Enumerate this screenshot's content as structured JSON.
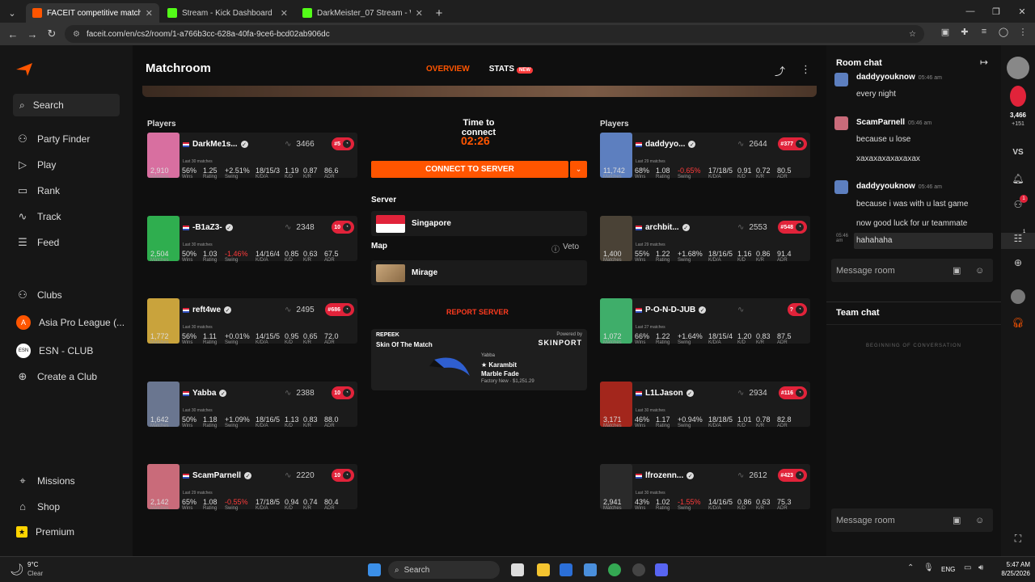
{
  "browser": {
    "tabs": [
      {
        "title": "FACEIT competitive match - FA",
        "color": "#ff5500"
      },
      {
        "title": "Stream - Kick Dashboard",
        "color": "#53fc18"
      },
      {
        "title": "DarkMeister_07 Stream - Watch",
        "color": "#53fc18"
      }
    ],
    "url": "faceit.com/en/cs2/room/1-a766b3cc-628a-40fa-9ce6-bcd02ab906dc"
  },
  "sidebar": {
    "search_label": "Search",
    "items": [
      "Party Finder",
      "Play",
      "Rank",
      "Track",
      "Feed"
    ],
    "clubs": [
      "Clubs",
      "Asia Pro League (...",
      "ESN - CLUB",
      "Create a Club"
    ],
    "bottom": [
      "Missions",
      "Shop",
      "Premium"
    ]
  },
  "header": {
    "title": "Matchroom",
    "tab_overview": "OVERVIEW",
    "tab_stats": "STATS",
    "new_badge": "NEW"
  },
  "left_team": {
    "label": "Players",
    "players": [
      {
        "name": "DarkMe1s...",
        "elo": "3466",
        "level": "#5",
        "last": "Last 30 matches",
        "matches": "2,910",
        "wins": "56%",
        "rating": "1.25",
        "swing": "+2.51%",
        "kda": "18/15/3",
        "kd": "1.19",
        "kr": "0.87",
        "adr": "86.6",
        "avatar": "#d86fa0"
      },
      {
        "name": "-B1aZ3-",
        "elo": "2348",
        "level": "10",
        "last": "Last 30 matches",
        "matches": "2,504",
        "wins": "50%",
        "rating": "1.03",
        "swing": "-1.46%",
        "kda": "14/16/4",
        "kd": "0.85",
        "kr": "0.63",
        "adr": "67.5",
        "avatar": "#2fae4f"
      },
      {
        "name": "reft4we",
        "elo": "2495",
        "level": "#686",
        "last": "Last 30 matches",
        "matches": "1,772",
        "wins": "56%",
        "rating": "1.11",
        "swing": "+0.01%",
        "kda": "14/15/5",
        "kd": "0.95",
        "kr": "0.65",
        "adr": "72.0",
        "avatar": "#c9a33c"
      },
      {
        "name": "Yabba",
        "elo": "2388",
        "level": "10",
        "last": "Last 30 matches",
        "matches": "1,642",
        "wins": "50%",
        "rating": "1.18",
        "swing": "+1.09%",
        "kda": "18/16/5",
        "kd": "1.13",
        "kr": "0.83",
        "adr": "88.0",
        "avatar": "#6a7690"
      },
      {
        "name": "ScamParnell",
        "elo": "2220",
        "level": "10",
        "last": "Last 29 matches",
        "matches": "2,142",
        "wins": "65%",
        "rating": "1.08",
        "swing": "-0.55%",
        "kda": "17/18/5",
        "kd": "0.94",
        "kr": "0.74",
        "adr": "80.4",
        "avatar": "#c96b7a"
      }
    ]
  },
  "right_team": {
    "label": "Players",
    "players": [
      {
        "name": "daddyyo...",
        "elo": "2644",
        "level": "#377",
        "last": "Last 29 matches",
        "matches": "11,742",
        "wins": "68%",
        "rating": "1.08",
        "swing": "-0.65%",
        "kda": "17/18/5",
        "kd": "0.91",
        "kr": "0.72",
        "adr": "80.5",
        "avatar": "#5d7fbf"
      },
      {
        "name": "archbit...",
        "elo": "2553",
        "level": "#548",
        "last": "Last 29 matches",
        "matches": "1,400",
        "wins": "55%",
        "rating": "1.22",
        "swing": "+1.68%",
        "kda": "18/16/5",
        "kd": "1.16",
        "kr": "0.86",
        "adr": "91.4",
        "avatar": "#4a4236"
      },
      {
        "name": "P-O-N-D-JUB",
        "elo": "",
        "level": "?",
        "last": "Last 27 matches",
        "matches": "1,072",
        "wins": "66%",
        "rating": "1.22",
        "swing": "+1.64%",
        "kda": "18/15/4",
        "kd": "1.20",
        "kr": "0.83",
        "adr": "87.5",
        "avatar": "#3fae6a"
      },
      {
        "name": "L1LJason",
        "elo": "2934",
        "level": "#116",
        "last": "Last 30 matches",
        "matches": "3,171",
        "wins": "46%",
        "rating": "1.17",
        "swing": "+0.94%",
        "kda": "18/18/5",
        "kd": "1.01",
        "kr": "0.78",
        "adr": "82.8",
        "avatar": "#a3261c"
      },
      {
        "name": "lfrozenn...",
        "elo": "2612",
        "level": "#423",
        "last": "Last 30 matches",
        "matches": "2,941",
        "wins": "43%",
        "rating": "1.02",
        "swing": "-1.55%",
        "kda": "14/16/5",
        "kd": "0.86",
        "kr": "0.63",
        "adr": "75.3",
        "avatar": "#2a2a2a"
      }
    ]
  },
  "stat_labels": {
    "matches": "Matches",
    "wins": "Wins",
    "rating": "Rating",
    "swing": "Swing",
    "kda": "K/D/A",
    "kd": "K/D",
    "kr": "K/R",
    "adr": "ADR"
  },
  "center": {
    "time_label": "Time to connect",
    "timer": "02:26",
    "connect": "CONNECT TO SERVER",
    "server_label": "Server",
    "server": "Singapore",
    "map_label": "Map",
    "veto": "Veto",
    "map": "Mirage",
    "report": "REPORT SERVER",
    "skin": {
      "brand": "REPEEK",
      "title": "Skin Of The Match",
      "powered": "Powered by",
      "partner": "SKINPORT",
      "owner": "Yabba",
      "item1": "★ Karambit",
      "item2": "Marble Fade",
      "price": "Factory New · $1,251.29"
    }
  },
  "chat": {
    "room_title": "Room chat",
    "messages": [
      {
        "user": "daddyyouknow",
        "time": "05:46 am",
        "lines": [
          "every night"
        ]
      },
      {
        "user": "ScamParnell",
        "time": "05:46 am",
        "lines": [
          "because u lose",
          "xaxaxaxaxaxaxax"
        ]
      },
      {
        "user": "daddyyouknow",
        "time": "05:46 am",
        "lines": [
          "because i was with u last game",
          "now good luck for ur teammate"
        ]
      }
    ],
    "last_time": "05:46 am",
    "last_line": "hahahaha",
    "placeholder": "Message room",
    "team_title": "Team chat",
    "beginning": "BEGINNING OF CONVERSATION"
  },
  "rail": {
    "points": "3,466",
    "plus": "+151",
    "vs": "VS",
    "badge1": "1",
    "badge2": "1"
  },
  "taskbar": {
    "temp": "9°C",
    "weather": "Clear",
    "search": "Search",
    "lang": "ENG",
    "time": "5:47 AM",
    "date": "8/25/2026"
  }
}
